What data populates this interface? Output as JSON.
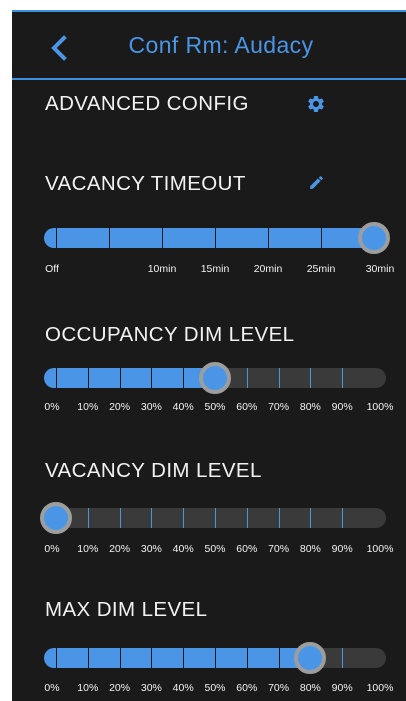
{
  "header": {
    "title": "Conf Rm: Audacy"
  },
  "advanced": {
    "title": "ADVANCED CONFIG"
  },
  "colors": {
    "accent": "#4b95e6",
    "background": "#1a1a1a",
    "track_empty": "#3a3a3a",
    "thumb_border": "#9d9d9d",
    "text": "#f2f2f2"
  },
  "icons": [
    "chevron-left-icon",
    "gear-icon",
    "pencil-icon"
  ],
  "sliders": [
    {
      "id": "vacancy-timeout",
      "title": "VACANCY TIMEOUT",
      "editable": true,
      "value": 30,
      "unit": "min",
      "tick_values": [
        0,
        5,
        10,
        15,
        20,
        25,
        30
      ],
      "labels": [
        {
          "text": "Off",
          "value": 0
        },
        {
          "text": "10min",
          "value": 10
        },
        {
          "text": "15min",
          "value": 15
        },
        {
          "text": "20min",
          "value": 20
        },
        {
          "text": "25min",
          "value": 25
        },
        {
          "text": "30min",
          "value": 30
        }
      ]
    },
    {
      "id": "occupancy-dim-level",
      "title": "OCCUPANCY DIM LEVEL",
      "value": 50,
      "unit": "%",
      "tick_values": [
        0,
        10,
        20,
        30,
        40,
        50,
        60,
        70,
        80,
        90,
        100
      ],
      "labels": [
        {
          "text": "0%",
          "value": 0
        },
        {
          "text": "10%",
          "value": 10
        },
        {
          "text": "20%",
          "value": 20
        },
        {
          "text": "30%",
          "value": 30
        },
        {
          "text": "40%",
          "value": 40
        },
        {
          "text": "50%",
          "value": 50
        },
        {
          "text": "60%",
          "value": 60
        },
        {
          "text": "70%",
          "value": 70
        },
        {
          "text": "80%",
          "value": 80
        },
        {
          "text": "90%",
          "value": 90
        },
        {
          "text": "100%",
          "value": 100
        }
      ]
    },
    {
      "id": "vacancy-dim-level",
      "title": "VACANCY DIM LEVEL",
      "value": 0,
      "unit": "%",
      "tick_values": [
        0,
        10,
        20,
        30,
        40,
        50,
        60,
        70,
        80,
        90,
        100
      ],
      "labels": [
        {
          "text": "0%",
          "value": 0
        },
        {
          "text": "10%",
          "value": 10
        },
        {
          "text": "20%",
          "value": 20
        },
        {
          "text": "30%",
          "value": 30
        },
        {
          "text": "40%",
          "value": 40
        },
        {
          "text": "50%",
          "value": 50
        },
        {
          "text": "60%",
          "value": 60
        },
        {
          "text": "70%",
          "value": 70
        },
        {
          "text": "80%",
          "value": 80
        },
        {
          "text": "90%",
          "value": 90
        },
        {
          "text": "100%",
          "value": 100
        }
      ]
    },
    {
      "id": "max-dim-level",
      "title": "MAX DIM LEVEL",
      "value": 80,
      "unit": "%",
      "tick_values": [
        0,
        10,
        20,
        30,
        40,
        50,
        60,
        70,
        80,
        90,
        100
      ],
      "labels": [
        {
          "text": "0%",
          "value": 0
        },
        {
          "text": "10%",
          "value": 10
        },
        {
          "text": "20%",
          "value": 20
        },
        {
          "text": "30%",
          "value": 30
        },
        {
          "text": "40%",
          "value": 40
        },
        {
          "text": "50%",
          "value": 50
        },
        {
          "text": "60%",
          "value": 60
        },
        {
          "text": "70%",
          "value": 70
        },
        {
          "text": "80%",
          "value": 80
        },
        {
          "text": "90%",
          "value": 90
        },
        {
          "text": "100%",
          "value": 100
        }
      ]
    }
  ]
}
